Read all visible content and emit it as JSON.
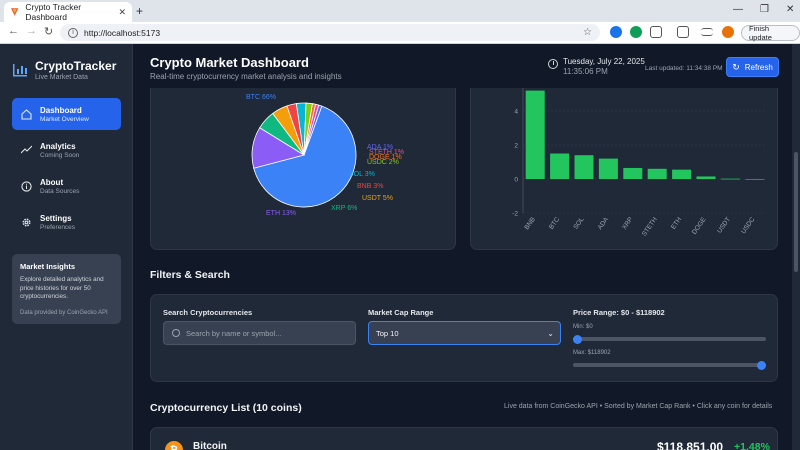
{
  "browser": {
    "tab_title": "Crypto Tracker Dashboard",
    "url": "http://localhost:5173",
    "finish_update": "Finish update"
  },
  "sidebar": {
    "brand_title": "CryptoTracker",
    "brand_sub": "Live Market Data",
    "items": [
      {
        "label": "Dashboard",
        "sub": "Market Overview",
        "icon": "home-icon",
        "active": true
      },
      {
        "label": "Analytics",
        "sub": "Coming Soon",
        "icon": "trend-icon",
        "active": false
      },
      {
        "label": "About",
        "sub": "Data Sources",
        "icon": "info-icon",
        "active": false
      },
      {
        "label": "Settings",
        "sub": "Preferences",
        "icon": "gear-icon",
        "active": false
      }
    ],
    "insights": {
      "title": "Market Insights",
      "body": "Explore detailed analytics and price histories for over 50 cryptocurrencies.",
      "footer": "Data provided by CoinGecko API"
    }
  },
  "header": {
    "title": "Crypto Market Dashboard",
    "subtitle": "Real-time cryptocurrency market analysis and insights",
    "date": "Tuesday, July 22, 2025",
    "time": "11:35:06 PM",
    "last_updated": "Last updated: 11:34:38 PM",
    "refresh_label": "Refresh"
  },
  "pie_chart": {
    "slices": [
      {
        "label": "BTC 66%",
        "value": 66,
        "color": "#3b82f6"
      },
      {
        "label": "ETH 13%",
        "value": 13,
        "color": "#8b5cf6"
      },
      {
        "label": "XRP 6%",
        "value": 6,
        "color": "#10b981"
      },
      {
        "label": "USDT 5%",
        "value": 5,
        "color": "#f59e0b"
      },
      {
        "label": "BNB 3%",
        "value": 3,
        "color": "#ef4444"
      },
      {
        "label": "SOL 3%",
        "value": 3,
        "color": "#06b6d4"
      },
      {
        "label": "USDC 2%",
        "value": 2,
        "color": "#84cc16"
      },
      {
        "label": "DOGE 1%",
        "value": 1,
        "color": "#f97316"
      },
      {
        "label": "STETH 1%",
        "value": 1,
        "color": "#ec4899"
      },
      {
        "label": "ADA 1%",
        "value": 1,
        "color": "#6366f1"
      }
    ]
  },
  "chart_data": {
    "type": "bar",
    "categories": [
      "BNB",
      "BTC",
      "SOL",
      "ADA",
      "XRP",
      "STETH",
      "ETH",
      "DOGE",
      "USDT",
      "USDC"
    ],
    "values": [
      5.2,
      1.5,
      1.4,
      1.2,
      0.65,
      0.6,
      0.55,
      0.15,
      0.02,
      -0.02
    ],
    "ylim": [
      -2,
      6
    ],
    "yticks": [
      "-2",
      "0",
      "2",
      "4"
    ],
    "color": "#22c55e"
  },
  "filters": {
    "title": "Filters & Search",
    "search_label": "Search Cryptocurrencies",
    "search_placeholder": "Search by name or symbol...",
    "cap_label": "Market Cap Range",
    "cap_value": "Top 10",
    "price_label": "Price Range: $0 - $118902",
    "min_label": "Min: $0",
    "max_label": "Max: $118902",
    "min_fraction": 0,
    "max_fraction": 1
  },
  "list": {
    "title": "Cryptocurrency List (10 coins)",
    "meta": "Live data from CoinGecko API • Sorted by Market Cap Rank • Click any coin for details",
    "coins": [
      {
        "name": "Bitcoin",
        "price": "$118,851.00",
        "change": "+1.48%",
        "logo": "₿"
      }
    ]
  }
}
